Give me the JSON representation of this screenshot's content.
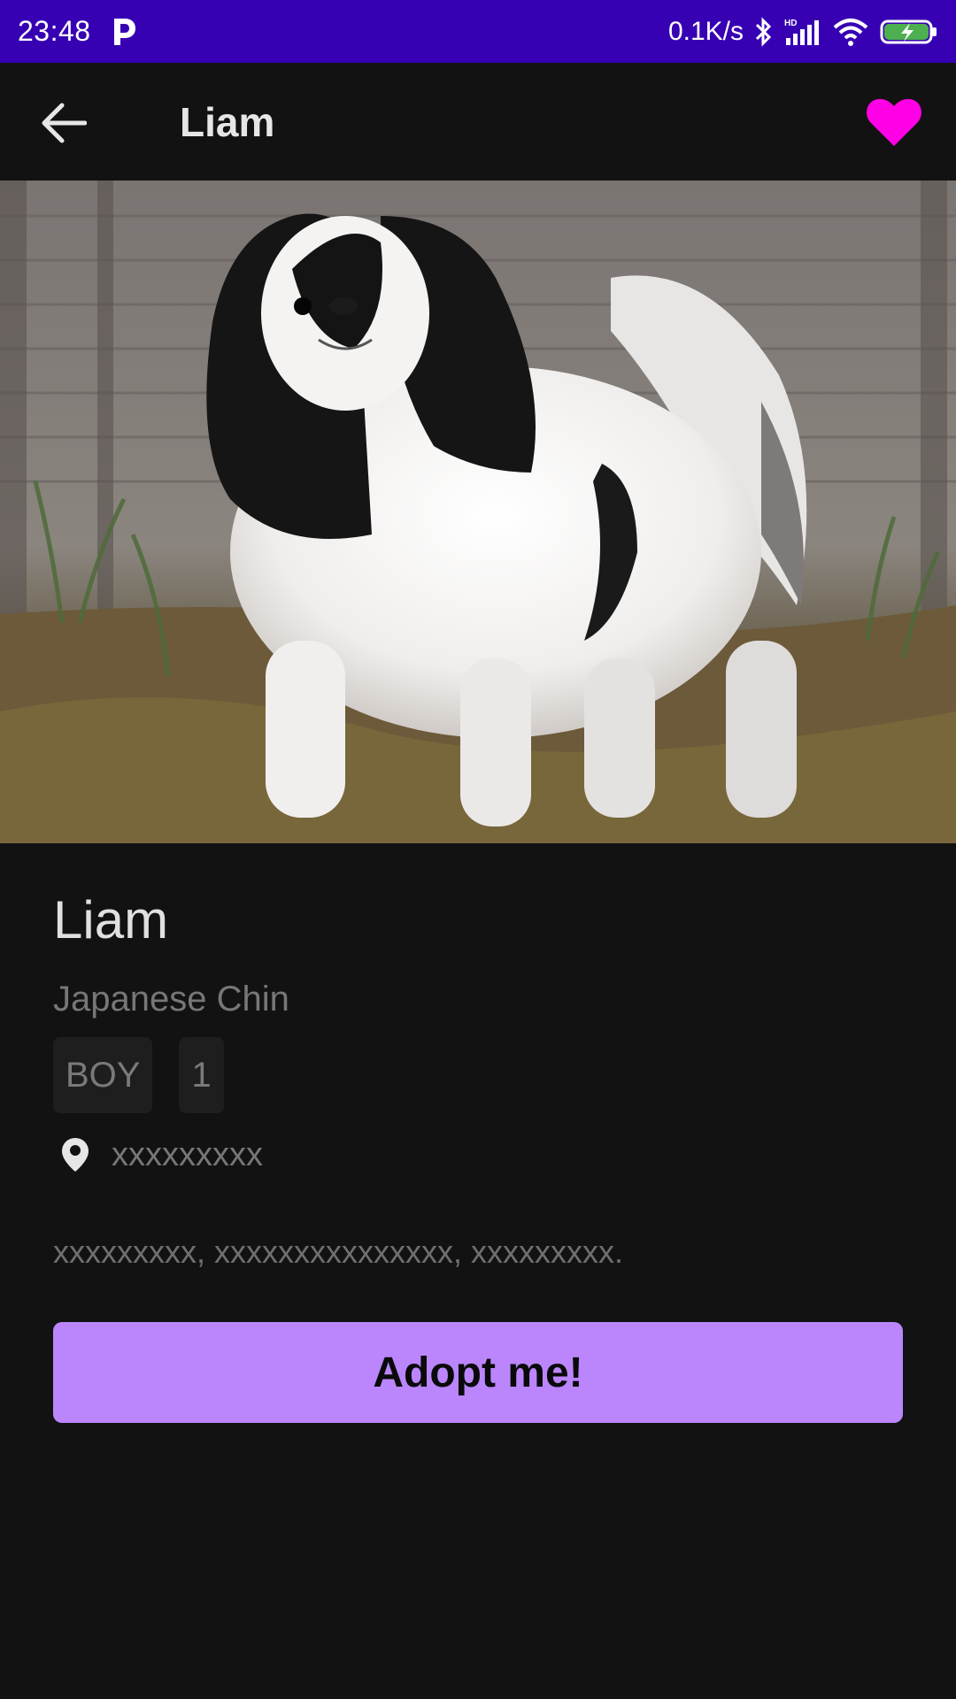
{
  "status_bar": {
    "time": "23:48",
    "network_speed": "0.1K/s",
    "icons": [
      "parking-p-icon",
      "bluetooth-icon",
      "hd-signal-icon",
      "wifi-icon",
      "battery-charging-icon"
    ]
  },
  "app_bar": {
    "title": "Liam",
    "back_icon": "arrow-back-icon",
    "favorite_icon": "heart-icon",
    "favorite_color": "#FF00E6"
  },
  "pet": {
    "name": "Liam",
    "breed": "Japanese Chin",
    "gender": "BOY",
    "age": "1",
    "location": "xxxxxxxxx",
    "description": "xxxxxxxxx, xxxxxxxxxxxxxxx, xxxxxxxxx."
  },
  "actions": {
    "adopt_label": "Adopt me!"
  },
  "colors": {
    "status_bar": "#3700B3",
    "background": "#121212",
    "accent": "#BB86FC"
  }
}
